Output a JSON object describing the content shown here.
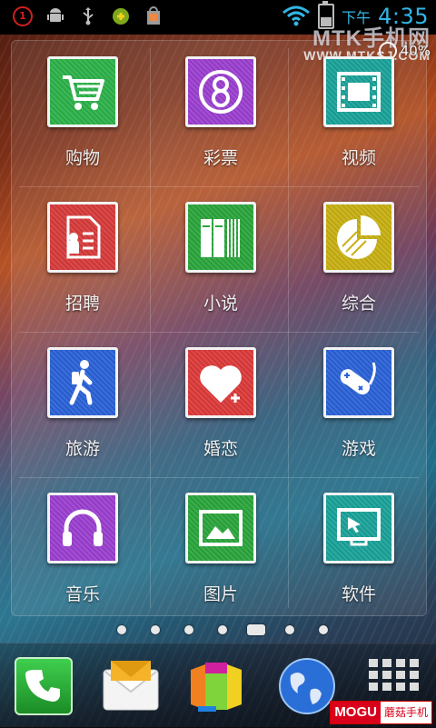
{
  "status_bar": {
    "notification_count": "1",
    "time_prefix": "下午",
    "time": "4:35",
    "battery_percent": "40%"
  },
  "watermark": {
    "line1": "MTK手机网",
    "line2": "WWW.MTKSJ.COM"
  },
  "apps": [
    {
      "label": "购物",
      "icon": "shopping-cart-icon",
      "color": "#2db24a"
    },
    {
      "label": "彩票",
      "icon": "lottery-icon",
      "color": "#9b3fd0"
    },
    {
      "label": "视频",
      "icon": "film-icon",
      "color": "#1aa39a"
    },
    {
      "label": "招聘",
      "icon": "resume-icon",
      "color": "#d83b3b"
    },
    {
      "label": "小说",
      "icon": "books-icon",
      "color": "#2aa63c"
    },
    {
      "label": "综合",
      "icon": "chart-pie-icon",
      "color": "#c8b012"
    },
    {
      "label": "旅游",
      "icon": "hiker-icon",
      "color": "#2a62d8"
    },
    {
      "label": "婚恋",
      "icon": "heart-icon",
      "color": "#dd3a3a"
    },
    {
      "label": "游戏",
      "icon": "gamepad-icon",
      "color": "#2a62d8"
    },
    {
      "label": "音乐",
      "icon": "headphones-icon",
      "color": "#9b3fd0"
    },
    {
      "label": "图片",
      "icon": "picture-icon",
      "color": "#2aa63c"
    },
    {
      "label": "软件",
      "icon": "monitor-icon",
      "color": "#1aa39a"
    }
  ],
  "page_indicator": {
    "count": 7,
    "active_index": 4
  },
  "dock": {
    "items": [
      "phone-icon",
      "messaging-icon",
      "gallery-icon",
      "browser-icon",
      "all-apps-icon"
    ]
  },
  "brand": {
    "part1": "MOGU",
    "part2": "蘑菇手机"
  }
}
